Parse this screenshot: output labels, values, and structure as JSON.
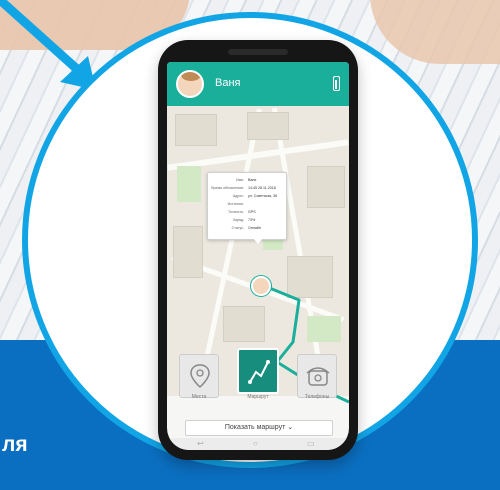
{
  "page": {
    "band_text": "ля"
  },
  "app": {
    "contact_name": "Ваня",
    "battery_icon": "battery-icon"
  },
  "info_card": {
    "rows": [
      {
        "label": "Имя:",
        "value": "Ваня"
      },
      {
        "label": "Время обновления:",
        "value": "14:45 28.11.2018"
      },
      {
        "label": "Адрес:",
        "value": "ул. Советская, 36"
      },
      {
        "label": "Источник:",
        "value": ""
      },
      {
        "label": "Точность:",
        "value": "GPS"
      },
      {
        "label": "Заряд:",
        "value": "73%"
      },
      {
        "label": "Статус:",
        "value": "Онлайн"
      }
    ]
  },
  "actions": {
    "places_label": "Места",
    "route_label": "Маршрут",
    "phones_label": "Телефоны",
    "show_route_label": "Показать маршрут ⌄"
  },
  "colors": {
    "header": "#1aaf9a",
    "route": "#1aaf9a",
    "ring": "#12a5e6",
    "band": "#0b6fc1"
  }
}
